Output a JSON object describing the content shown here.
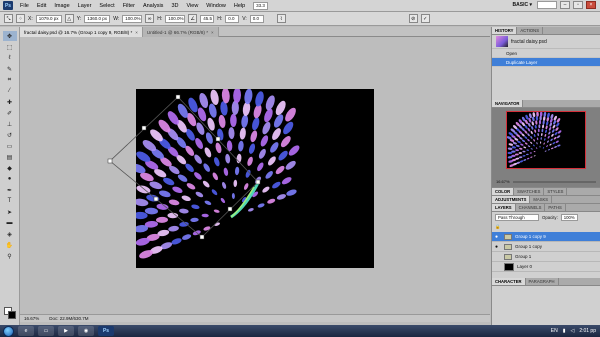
{
  "app": {
    "logo": "Ps"
  },
  "menu": [
    "File",
    "Edit",
    "Image",
    "Layer",
    "Select",
    "Filter",
    "Analysis",
    "3D",
    "View",
    "Window",
    "Help"
  ],
  "menu_right": {
    "zoom": "33.3",
    "workspace": "BASIC ▾"
  },
  "options": {
    "x_label": "X:",
    "x_value": "1079.0 px",
    "y_label": "Y:",
    "y_value": "1360.0 px",
    "w_label": "W:",
    "w_value": "100.0%",
    "h_label": "H:",
    "h_value": "100.0%",
    "angle_value": "45.5",
    "hskew_label": "H:",
    "hskew_value": "0.0",
    "vskew_label": "V:",
    "vskew_value": "0.0"
  },
  "doc_tabs": [
    {
      "title": "fractal daisy.psd @ 16.7% (Group 1 copy 9, RGB/8) *",
      "close": "×"
    },
    {
      "title": "Untitled-1 @ 66.7% (RGB/8) *",
      "close": "×"
    }
  ],
  "status": {
    "zoom": "16.67%",
    "doc": "Doc: 22.9M/630.7M"
  },
  "history": {
    "tabs": [
      "HISTORY",
      "ACTIONS"
    ],
    "snapshot": "fractal daisy.psd",
    "items": [
      "Open",
      "Duplicate Layer"
    ]
  },
  "navigator": {
    "tab": "NAVIGATOR",
    "zoom": "16.67%"
  },
  "color_tabs": [
    "COLOR",
    "SWATCHES",
    "STYLES"
  ],
  "adj_tabs": [
    "ADJUSTMENTS",
    "MASKS"
  ],
  "layers": {
    "tabs": [
      "LAYERS",
      "CHANNELS",
      "PATHS"
    ],
    "blend": "Pass Through",
    "opacity_label": "Opacity:",
    "opacity_value": "100%",
    "items": [
      "Group 1 copy 9",
      "Group 1 copy",
      "Group 1",
      "Layer 0"
    ]
  },
  "char_tabs": [
    "CHARACTER",
    "PARAGRAPH"
  ],
  "taskbar": {
    "lang": "EN",
    "time": "2:01 pp"
  },
  "icons": [
    "move-icon",
    "marquee-icon",
    "lasso-icon",
    "quick-select-icon",
    "crop-icon",
    "eyedropper-icon",
    "healing-icon",
    "brush-icon",
    "clone-stamp-icon",
    "history-brush-icon",
    "eraser-icon",
    "gradient-icon",
    "blur-icon",
    "dodge-icon",
    "pen-icon",
    "type-icon",
    "path-select-icon",
    "shape-icon",
    "3d-icon",
    "hand-icon",
    "zoom-icon"
  ]
}
